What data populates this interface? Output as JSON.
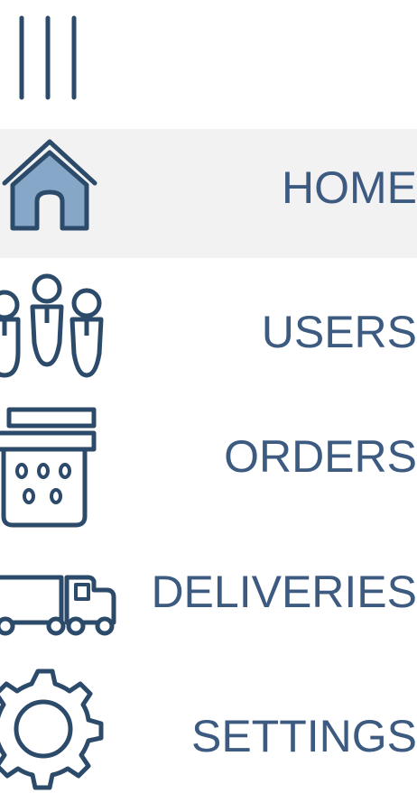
{
  "app": {
    "menu_toggle_icon": "hamburger-vertical-icon"
  },
  "nav": {
    "items": [
      {
        "id": "home",
        "label": "HOME",
        "icon": "home-icon",
        "active": true
      },
      {
        "id": "users",
        "label": "USERS",
        "icon": "users-icon",
        "active": false
      },
      {
        "id": "orders",
        "label": "ORDERS",
        "icon": "orders-icon",
        "active": false
      },
      {
        "id": "deliveries",
        "label": "DELIVERIES",
        "icon": "truck-icon",
        "active": false
      },
      {
        "id": "settings",
        "label": "SETTINGS",
        "icon": "gear-icon",
        "active": false
      }
    ]
  },
  "colors": {
    "stroke": "#2c4a6a",
    "text": "#3d5a80",
    "active_background": "#f2f2f2",
    "home_fill": "#86a7c8"
  }
}
